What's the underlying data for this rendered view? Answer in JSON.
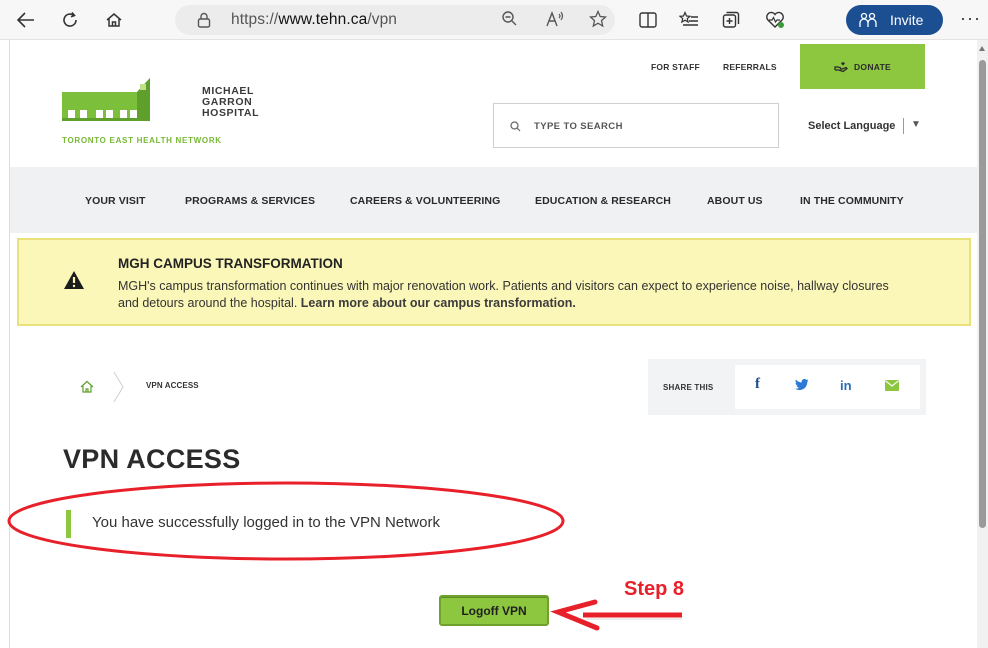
{
  "browser": {
    "url_prefix": "https://",
    "url_domain": "www.tehn.ca",
    "url_path": "/vpn",
    "invite_label": "Invite",
    "more_label": "···"
  },
  "header": {
    "logo_lines": [
      "MICHAEL",
      "GARRON",
      "HOSPITAL"
    ],
    "logo_subtitle": "TORONTO EAST HEALTH NETWORK",
    "top_links": [
      "FOR STAFF",
      "REFERRALS"
    ],
    "donate_label": "DONATE",
    "search_placeholder": "TYPE TO SEARCH",
    "language_label": "Select Language",
    "language_arrow": "▼"
  },
  "nav": {
    "items": [
      "YOUR VISIT",
      "PROGRAMS & SERVICES",
      "CAREERS & VOLUNTEERING",
      "EDUCATION & RESEARCH",
      "ABOUT US",
      "IN THE COMMUNITY"
    ]
  },
  "alert": {
    "title": "MGH CAMPUS TRANSFORMATION",
    "body": "MGH's campus transformation continues with major renovation work. Patients and visitors can expect to experience noise, hallway closures and detours around the hospital.",
    "link_text": "Learn more about our campus transformation."
  },
  "breadcrumb": {
    "current": "VPN ACCESS"
  },
  "share": {
    "label": "SHARE THIS",
    "facebook": "f",
    "linkedin": "in"
  },
  "main": {
    "title": "VPN ACCESS",
    "message": "You have successfully logged in to the VPN Network",
    "logoff_label": "Logoff VPN"
  },
  "annotation": {
    "step_label": "Step 8",
    "color": "#e8202a"
  },
  "colors": {
    "brand_green": "#8dc63f",
    "alert_bg": "#fbf7b8",
    "invite_blue": "#1b4f91"
  }
}
